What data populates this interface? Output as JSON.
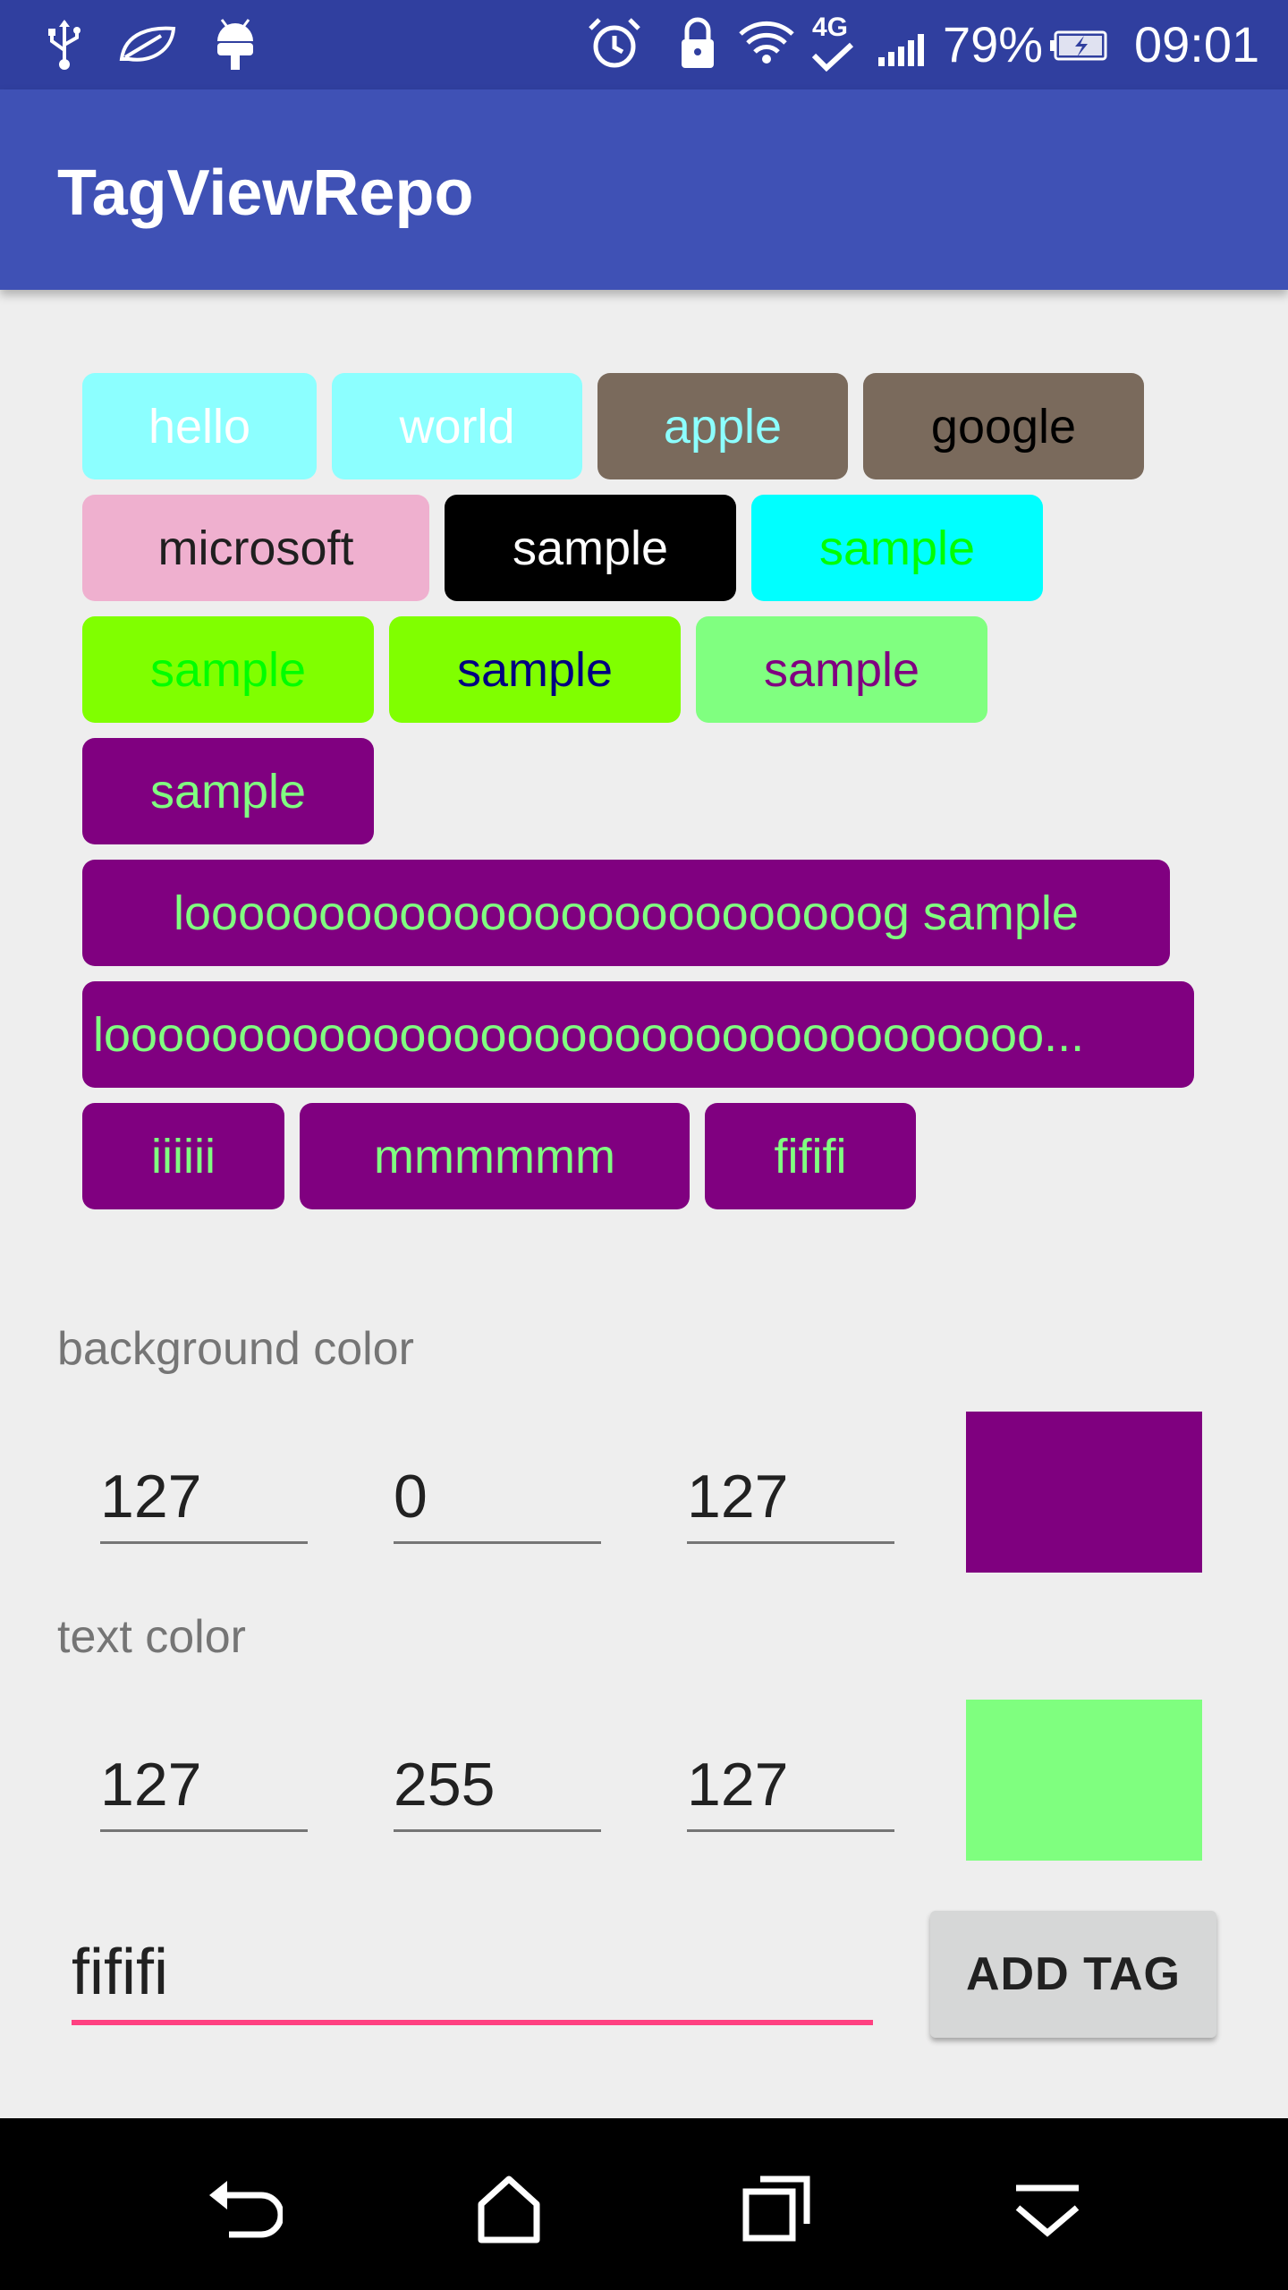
{
  "status_bar": {
    "battery": "79%",
    "time": "09:01",
    "network": "4G",
    "icons": [
      "usb-icon",
      "leaf-icon",
      "android-icon",
      "alarm-icon",
      "lock-icon",
      "wifi-icon",
      "network-4g-icon",
      "signal-icon",
      "battery-charging-icon"
    ]
  },
  "app_bar": {
    "title": "TagViewRepo"
  },
  "tags": [
    [
      {
        "label": "hello",
        "bg": "#8CFFFF",
        "fg": "#FFFFFF"
      },
      {
        "label": "world",
        "bg": "#8CFFFF",
        "fg": "#FFFFFF"
      },
      {
        "label": "apple",
        "bg": "#7A6A5C",
        "fg": "#8CFFFF"
      },
      {
        "label": "google",
        "bg": "#7A6A5C",
        "fg": "#000000"
      }
    ],
    [
      {
        "label": "microsoft",
        "bg": "#EFB0CF",
        "fg": "#1F1F1F"
      },
      {
        "label": "sample",
        "bg": "#000000",
        "fg": "#FFFFFF"
      },
      {
        "label": "sample",
        "bg": "#00FFFF",
        "fg": "#00FF00"
      }
    ],
    [
      {
        "label": "sample",
        "bg": "#80FF00",
        "fg": "#00FF00"
      },
      {
        "label": "sample",
        "bg": "#80FF00",
        "fg": "#000080"
      },
      {
        "label": "sample",
        "bg": "#80FF80",
        "fg": "#800080"
      }
    ],
    [
      {
        "label": "sample",
        "bg": "#800080",
        "fg": "#80FF80"
      }
    ],
    [
      {
        "label": "loooooooooooooooooooooooooog sample",
        "bg": "#800080",
        "fg": "#80FF80"
      }
    ],
    [
      {
        "label": "looooooooooooooooooooooooooooooooooo...",
        "bg": "#800080",
        "fg": "#80FF80",
        "ellipsis": true
      }
    ],
    [
      {
        "label": "iiiiii",
        "bg": "#800080",
        "fg": "#80FF80"
      },
      {
        "label": "mmmmmm",
        "bg": "#800080",
        "fg": "#80FF80"
      },
      {
        "label": "fififi",
        "bg": "#800080",
        "fg": "#80FF80"
      }
    ]
  ],
  "background_color": {
    "label": "background color",
    "r": "127",
    "g": "0",
    "b": "127",
    "swatch": "#7F007F"
  },
  "text_color": {
    "label": "text color",
    "r": "127",
    "g": "255",
    "b": "127",
    "swatch": "#7FFF7F"
  },
  "tag_input": {
    "value": "fififi"
  },
  "add_button": {
    "label": "ADD TAG"
  },
  "nav_bar": {
    "icons": [
      "back-icon",
      "home-icon",
      "recents-icon",
      "notification-pull-icon"
    ]
  },
  "colors": {
    "status_bar": "#303F9F",
    "app_bar": "#3F51B5",
    "accent": "#FF4081"
  }
}
